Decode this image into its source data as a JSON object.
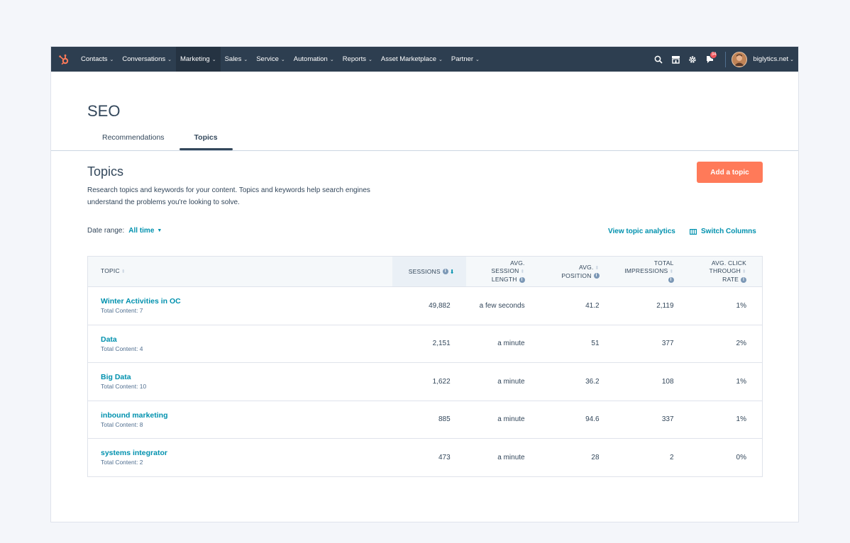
{
  "nav": {
    "items": [
      {
        "label": "Contacts"
      },
      {
        "label": "Conversations"
      },
      {
        "label": "Marketing"
      },
      {
        "label": "Sales"
      },
      {
        "label": "Service"
      },
      {
        "label": "Automation"
      },
      {
        "label": "Reports"
      },
      {
        "label": "Asset Marketplace"
      },
      {
        "label": "Partner"
      }
    ],
    "active_item": "Marketing",
    "notification_count": "34",
    "account": "biglytics.net"
  },
  "page": {
    "title": "SEO",
    "tabs": [
      {
        "label": "Recommendations"
      },
      {
        "label": "Topics"
      }
    ],
    "active_tab": "Topics"
  },
  "section": {
    "title": "Topics",
    "description": "Research topics and keywords for your content. Topics and keywords help search engines understand the problems you're looking to solve.",
    "add_button": "Add a topic",
    "date_range_label": "Date range:",
    "date_range_value": "All time",
    "analytics_link": "View topic analytics",
    "switch_columns": "Switch Columns"
  },
  "table": {
    "headers": {
      "topic": "TOPIC",
      "sessions": "SESSIONS",
      "avg_session_1": "AVG.",
      "avg_session_2": "SESSION",
      "avg_session_3": "LENGTH",
      "avg_position_1": "AVG.",
      "avg_position_2": "POSITION",
      "impressions_1": "TOTAL",
      "impressions_2": "IMPRESSIONS",
      "ctr_1": "AVG. CLICK",
      "ctr_2": "THROUGH",
      "ctr_3": "RATE"
    },
    "rows": [
      {
        "topic": "Winter Activities in OC",
        "sub": "Total Content: 7",
        "sessions": "49,882",
        "session_length": "a few seconds",
        "position": "41.2",
        "impressions": "2,119",
        "ctr": "1%"
      },
      {
        "topic": "Data",
        "sub": "Total Content: 4",
        "sessions": "2,151",
        "session_length": "a minute",
        "position": "51",
        "impressions": "377",
        "ctr": "2%"
      },
      {
        "topic": "Big Data",
        "sub": "Total Content: 10",
        "sessions": "1,622",
        "session_length": "a minute",
        "position": "36.2",
        "impressions": "108",
        "ctr": "1%"
      },
      {
        "topic": "inbound marketing",
        "sub": "Total Content: 8",
        "sessions": "885",
        "session_length": "a minute",
        "position": "94.6",
        "impressions": "337",
        "ctr": "1%"
      },
      {
        "topic": "systems integrator",
        "sub": "Total Content: 2",
        "sessions": "473",
        "session_length": "a minute",
        "position": "28",
        "impressions": "2",
        "ctr": "0%"
      }
    ]
  },
  "colors": {
    "nav_bg": "#2d3e50",
    "accent_link": "#0091ae",
    "primary_button": "#ff7a59",
    "badge": "#f2545b"
  }
}
